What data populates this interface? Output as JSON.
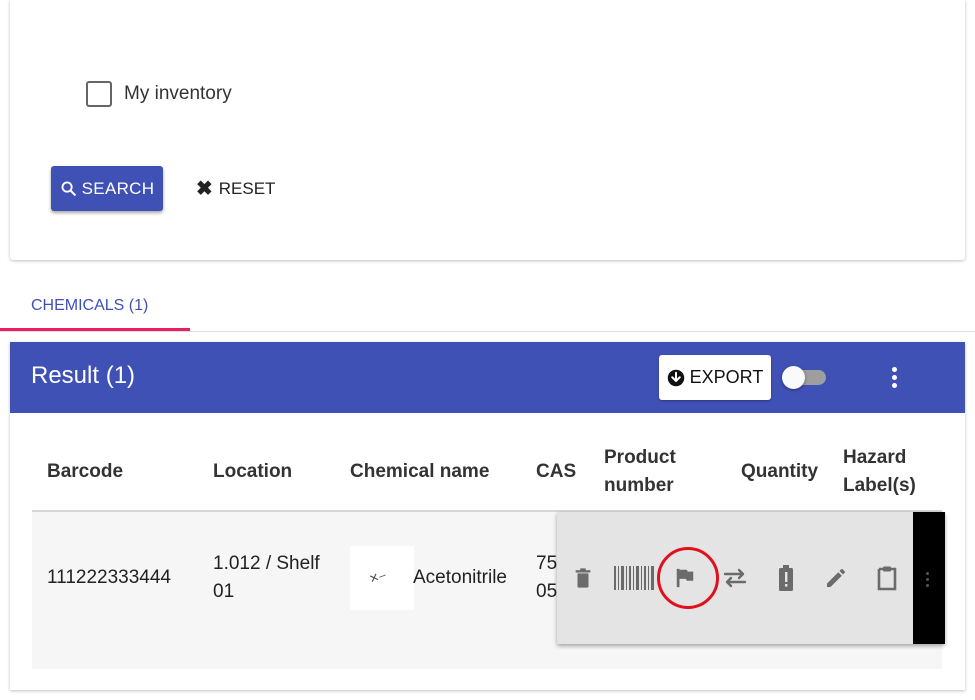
{
  "filters": {
    "my_inventory_label": "My inventory",
    "search_label": "SEARCH",
    "reset_label": "RESET"
  },
  "tabs": [
    {
      "label": "CHEMICALS (1)",
      "active": true
    }
  ],
  "results": {
    "title": "Result (1)",
    "export_label": "EXPORT",
    "columns": {
      "barcode": "Barcode",
      "location": "Location",
      "chemical_name": "Chemical name",
      "cas": "CAS",
      "product_number": "Product number",
      "quantity": "Quantity",
      "hazard_labels": "Hazard Label(s)"
    },
    "rows": [
      {
        "barcode": "111222333444",
        "location": "1.012 / Shelf 01",
        "chemical_name": "Acetonitrile",
        "cas": "75 05"
      }
    ],
    "row_actions": [
      "trash-icon",
      "barcode-icon",
      "flag-icon",
      "transfer-icon",
      "battery-alert-icon",
      "pencil-icon",
      "clipboard-icon"
    ]
  },
  "colors": {
    "primary": "#3f51b5",
    "tab_indicator": "#e91e63",
    "highlight_circle": "#e0101c"
  }
}
